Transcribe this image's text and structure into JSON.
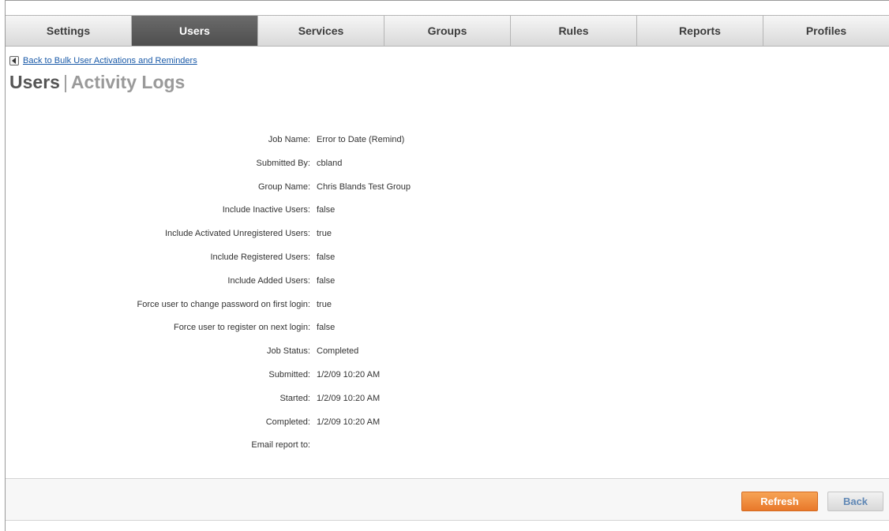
{
  "tabs": [
    {
      "label": "Settings",
      "active": false
    },
    {
      "label": "Users",
      "active": true
    },
    {
      "label": "Services",
      "active": false
    },
    {
      "label": "Groups",
      "active": false
    },
    {
      "label": "Rules",
      "active": false
    },
    {
      "label": "Reports",
      "active": false
    },
    {
      "label": "Profiles",
      "active": false
    }
  ],
  "back_link": {
    "icon": "arrow-left-icon",
    "label": "Back to Bulk User Activations and Reminders"
  },
  "title": {
    "primary": "Users",
    "separator": "|",
    "secondary": "Activity Logs"
  },
  "details": [
    {
      "label": "Job Name:",
      "value": "Error to Date (Remind)"
    },
    {
      "label": "Submitted By:",
      "value": "cbland"
    },
    {
      "label": "Group Name:",
      "value": "Chris Blands Test Group"
    },
    {
      "label": "Include Inactive Users:",
      "value": "false"
    },
    {
      "label": "Include Activated Unregistered Users:",
      "value": "true"
    },
    {
      "label": "Include Registered Users:",
      "value": "false"
    },
    {
      "label": "Include Added Users:",
      "value": "false"
    },
    {
      "label": "Force user to change password on first login:",
      "value": "true"
    },
    {
      "label": "Force user to register on next login:",
      "value": "false"
    },
    {
      "label": "Job Status:",
      "value": "Completed"
    },
    {
      "label": "Submitted:",
      "value": "1/2/09 10:20 AM"
    },
    {
      "label": "Started:",
      "value": "1/2/09 10:20 AM"
    },
    {
      "label": "Completed:",
      "value": "1/2/09 10:20 AM"
    },
    {
      "label": "Email report to:",
      "value": ""
    }
  ],
  "buttons": {
    "refresh": "Refresh",
    "back": "Back"
  },
  "colors": {
    "active_tab": "#555555",
    "refresh_button": "#ef8a3c",
    "link": "#1a5aa8"
  }
}
